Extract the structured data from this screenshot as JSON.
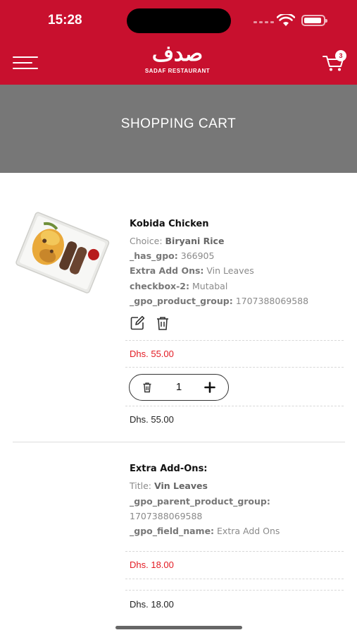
{
  "status_bar": {
    "time": "15:28"
  },
  "header": {
    "logo_arabic": "صدف",
    "logo_english": "SADAF RESTAURANT",
    "cart_count": "3",
    "accent_color": "#c8102e"
  },
  "banner": {
    "title": "SHOPPING CART"
  },
  "items": [
    {
      "name": "Kobida Chicken",
      "meta": [
        {
          "key": "Choice:",
          "value": "Biryani Rice"
        },
        {
          "key": "_has_gpo:",
          "value": "366905"
        },
        {
          "key": "Extra Add Ons:",
          "value": "Vin Leaves"
        },
        {
          "key": "checkbox-2:",
          "value": "Mutabal"
        },
        {
          "key": "_gpo_product_group:",
          "value": "1707388069588"
        }
      ],
      "price": "Dhs. 55.00",
      "quantity": "1",
      "subtotal": "Dhs. 55.00"
    },
    {
      "name": "Extra Add-Ons:",
      "meta": [
        {
          "key": "Title:",
          "value": "Vin Leaves"
        },
        {
          "key": "_gpo_parent_product_group:",
          "value": "1707388069588"
        },
        {
          "key": "_gpo_field_name:",
          "value": "Extra Add Ons"
        }
      ],
      "price": "Dhs. 18.00",
      "subtotal": "Dhs. 18.00"
    }
  ],
  "icons": {
    "menu": "hamburger-icon",
    "cart": "cart-icon",
    "edit": "edit-icon",
    "delete": "trash-icon",
    "plus": "plus-icon"
  },
  "colors": {
    "price": "#e31b23",
    "banner": "#777777"
  }
}
